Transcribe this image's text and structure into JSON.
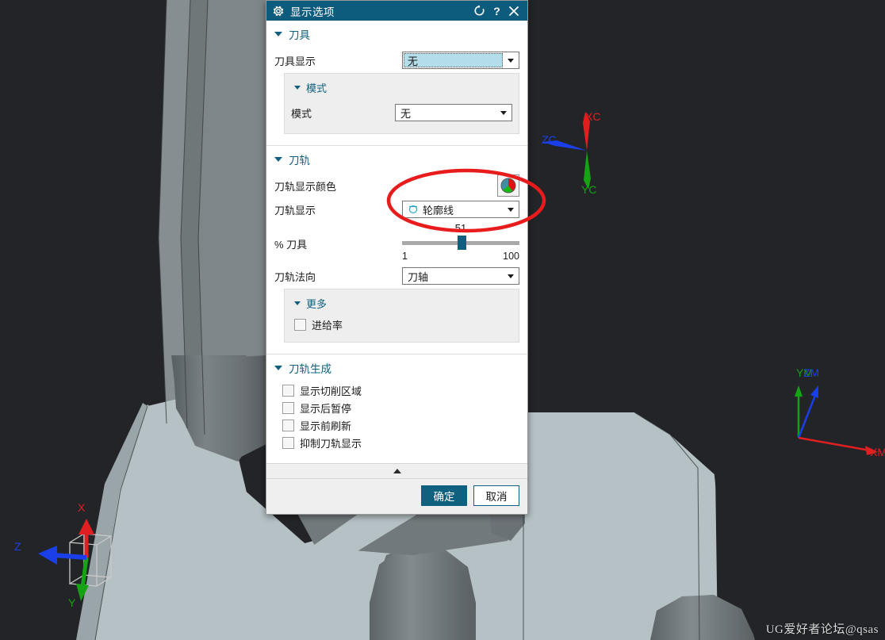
{
  "dialog": {
    "title": "显示选项",
    "title_icon": "gear-icon",
    "titlebar_buttons": [
      {
        "name": "reset-icon",
        "label": "↻"
      },
      {
        "name": "help-icon",
        "label": "?"
      },
      {
        "name": "close-icon",
        "label": "✕"
      }
    ],
    "sections": [
      {
        "name": "tool",
        "label": "刀具",
        "expanded": true,
        "rows": [
          {
            "label": "刀具显示",
            "value": "无",
            "type": "combobox",
            "focused": true
          }
        ],
        "group": {
          "label": "模式",
          "rows": [
            {
              "label": "模式",
              "value": "无",
              "type": "combobox"
            }
          ]
        }
      },
      {
        "name": "toolpath",
        "label": "刀轨",
        "expanded": true,
        "rows": [
          {
            "label": "刀轨显示颜色",
            "type": "color-swatch"
          },
          {
            "label": "刀轨显示",
            "value": "轮廓线",
            "type": "combobox",
            "icon": "contour-circle-icon"
          },
          {
            "label": "% 刀具",
            "type": "slider"
          },
          {
            "label": "刀轨法向",
            "value": "刀轴",
            "type": "combobox"
          }
        ],
        "slider": {
          "value": "51",
          "min": "1",
          "max": "100",
          "percent": 51
        },
        "group": {
          "label": "更多",
          "checkboxes": [
            {
              "label": "进给率",
              "checked": false
            }
          ]
        }
      },
      {
        "name": "toolpath-generation",
        "label": "刀轨生成",
        "expanded": true,
        "checkboxes": [
          {
            "label": "显示切削区域",
            "checked": false
          },
          {
            "label": "显示后暂停",
            "checked": false
          },
          {
            "label": "显示前刷新",
            "checked": false
          },
          {
            "label": "抑制刀轨显示",
            "checked": false
          }
        ]
      }
    ],
    "footer": {
      "ok_label": "确定",
      "cancel_label": "取消"
    },
    "colors": {
      "titlebar": "#0d5c7d",
      "accent": "#10617f",
      "highlight": "#b3ddea"
    }
  },
  "viewport": {
    "background_color": "#232428",
    "model_face_light": "#b5c0c4",
    "model_face_dark": "#6c7376",
    "wcs_triad": {
      "name": "wcs-triad",
      "axes": [
        {
          "label": "XC",
          "color": "#e02020"
        },
        {
          "label": "YC",
          "color": "#13a313"
        },
        {
          "label": "ZC",
          "color": "#1a3fe8"
        }
      ]
    },
    "mcs_triad": {
      "name": "mcs-triad",
      "axes": [
        {
          "label": "XM",
          "color": "#e02020"
        },
        {
          "label": "YM",
          "color": "#13a313"
        },
        {
          "label": "ZM",
          "color": "#1a3fe8"
        }
      ]
    },
    "acs_triad": {
      "name": "acs-triad",
      "axes": [
        {
          "label": "X",
          "color": "#e02020"
        },
        {
          "label": "Y",
          "color": "#13a313"
        },
        {
          "label": "Z",
          "color": "#1a3fe8"
        }
      ]
    },
    "watermark": "UG爱好者论坛@qsas"
  },
  "annotation": {
    "name": "red-ellipse-highlight",
    "color": "#e81c1c"
  }
}
